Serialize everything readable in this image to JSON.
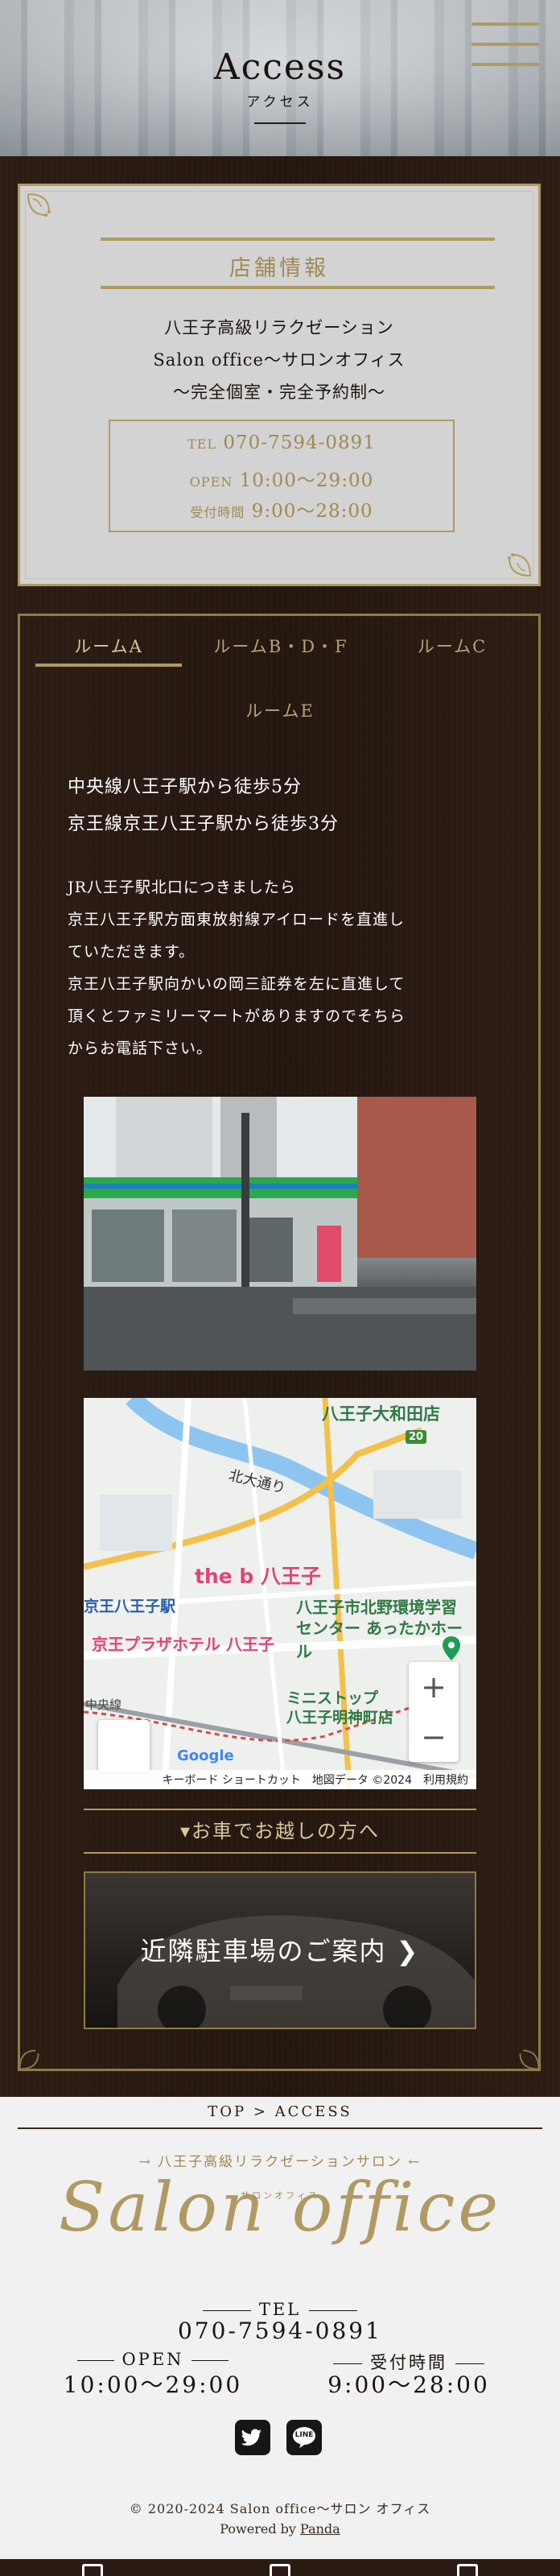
{
  "header": {
    "title": "Access",
    "subtitle": "アクセス",
    "menu_icon": "hamburger-menu-icon"
  },
  "shop": {
    "heading": "店舗情報",
    "lines": [
      "八王子高級リラクゼーション",
      "Salon office〜サロンオフィス",
      "〜完全個室・完全予約制〜"
    ],
    "tel_label": "TEL",
    "tel": "070-7594-0891",
    "open_label": "OPEN",
    "open_hours": "10:00〜29:00",
    "reception_label": "受付時間",
    "reception_hours": "9:00〜28:00"
  },
  "rooms": {
    "tabs": [
      "ルームA",
      "ルームB・D・F",
      "ルームC",
      "ルームE"
    ],
    "active_tab": "ルームA",
    "station_lines": [
      "中央線八王子駅から徒歩5分",
      "京王線京王八王子駅から徒歩3分"
    ],
    "directions": [
      "JR八王子駅北口につきましたら",
      "京王八王子駅方面東放射線アイロードを直進し",
      "ていただきます。",
      "京王八王子駅向かいの岡三証券を左に直進して",
      "頂くとファミリーマートがありますのでそちら",
      "からお電話下さい。"
    ],
    "map": {
      "labels": {
        "yamato": "八王子大和田店",
        "theb": "the b 八王子",
        "kitano": "八王子市北野環境学習",
        "kitano2": "センター あったかホール",
        "keio_station": "京王八王子駅",
        "keio_plaza": "京王プラザホテル 八王子",
        "ministop": "ミニストップ",
        "ministop2": "八王子明神町店",
        "kitaodori": "北大通り",
        "route": "20",
        "chuo": "中央線"
      },
      "footer": [
        "キーボード ショートカット",
        "地図データ ©2024",
        "利用規約"
      ],
      "brand": "Google",
      "zoom_in": "+",
      "zoom_out": "−"
    },
    "car_lead": "▾お車でお越しの方へ",
    "parking_button": "近隣駐車場のご案内 ❯"
  },
  "footer": {
    "breadcrumb": "TOP > ACCESS",
    "tagline": "→ 八王子高級リラクゼーションサロン ←",
    "logo_ruby": "サロンオフィス",
    "logo": "Salon office",
    "tel_label": "TEL",
    "tel": "070-7594-0891",
    "open_label": "OPEN",
    "open_hours": "10:00〜29:00",
    "reception_label": "受付時間",
    "reception_hours": "9:00〜28:00",
    "social": [
      "twitter-icon",
      "line-icon"
    ],
    "line_text": "LINE",
    "copyright": "© 2020-2024 Salon office〜サロン オフィス",
    "powered_prefix": "Powered by",
    "powered_link": "Panda"
  },
  "colors": {
    "gold": "#b09a62",
    "dark_brown": "#241710",
    "card_gray": "#d3d3d3",
    "footer_bg": "#f1f1f1"
  }
}
